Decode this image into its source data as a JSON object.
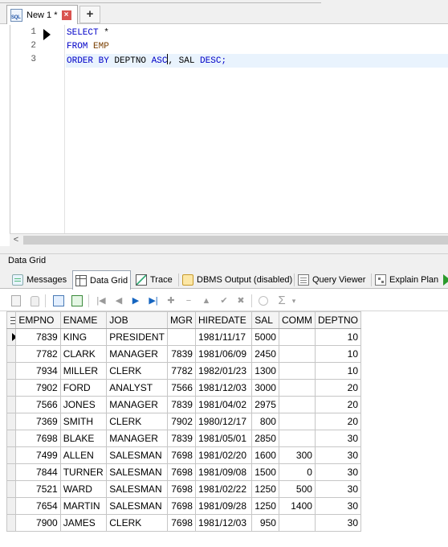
{
  "document_tab": {
    "title": "New 1 *",
    "icon": "sql-file-icon",
    "close_glyph": "×",
    "add_glyph": "+"
  },
  "editor": {
    "line_numbers": [
      "1",
      "2",
      "3"
    ],
    "lines": [
      {
        "t1": "SELECT",
        "t2": " *"
      },
      {
        "t1": "FROM",
        "t2": " ",
        "t3": "EMP"
      },
      {
        "t1": "ORDER BY",
        "t2": " DEPTNO ",
        "t3": "ASC",
        "t4": ", SAL ",
        "t5": "DESC;"
      }
    ],
    "colors": {
      "keyword": "#0000c8",
      "identifier": "#7a3f00",
      "active_line": "#e9f3fd"
    }
  },
  "scrollbar": {
    "left_arrow": "<"
  },
  "results_panel": {
    "title": "Data Grid",
    "tabs": [
      {
        "label": "Messages",
        "icon": "messages-icon"
      },
      {
        "label": "Data Grid",
        "icon": "data-grid-icon",
        "selected": true
      },
      {
        "label": "Trace",
        "icon": "trace-icon"
      },
      {
        "label": "DBMS Output (disabled)",
        "icon": "dbms-output-icon"
      },
      {
        "label": "Query Viewer",
        "icon": "query-viewer-icon"
      },
      {
        "label": "Explain Plan",
        "icon": "explain-plan-icon"
      }
    ]
  },
  "grid_toolbar": {
    "glyphs": {
      "first": "|◀",
      "prev": "◀",
      "next": "▶",
      "last": "▶|",
      "insert": "✚",
      "delete": "−",
      "up": "▲",
      "post": "✔",
      "cancel": "✖",
      "sum": "Σ",
      "dropdown": "▾"
    }
  },
  "grid": {
    "columns": [
      "EMPNO",
      "ENAME",
      "JOB",
      "MGR",
      "HIREDATE",
      "SAL",
      "COMM",
      "DEPTNO"
    ],
    "rows": [
      [
        "7839",
        "KING",
        "PRESIDENT",
        "",
        "1981/11/17",
        "5000",
        "",
        "10"
      ],
      [
        "7782",
        "CLARK",
        "MANAGER",
        "7839",
        "1981/06/09",
        "2450",
        "",
        "10"
      ],
      [
        "7934",
        "MILLER",
        "CLERK",
        "7782",
        "1982/01/23",
        "1300",
        "",
        "10"
      ],
      [
        "7902",
        "FORD",
        "ANALYST",
        "7566",
        "1981/12/03",
        "3000",
        "",
        "20"
      ],
      [
        "7566",
        "JONES",
        "MANAGER",
        "7839",
        "1981/04/02",
        "2975",
        "",
        "20"
      ],
      [
        "7369",
        "SMITH",
        "CLERK",
        "7902",
        "1980/12/17",
        "800",
        "",
        "20"
      ],
      [
        "7698",
        "BLAKE",
        "MANAGER",
        "7839",
        "1981/05/01",
        "2850",
        "",
        "30"
      ],
      [
        "7499",
        "ALLEN",
        "SALESMAN",
        "7698",
        "1981/02/20",
        "1600",
        "300",
        "30"
      ],
      [
        "7844",
        "TURNER",
        "SALESMAN",
        "7698",
        "1981/09/08",
        "1500",
        "0",
        "30"
      ],
      [
        "7521",
        "WARD",
        "SALESMAN",
        "7698",
        "1981/02/22",
        "1250",
        "500",
        "30"
      ],
      [
        "7654",
        "MARTIN",
        "SALESMAN",
        "7698",
        "1981/09/28",
        "1250",
        "1400",
        "30"
      ],
      [
        "7900",
        "JAMES",
        "CLERK",
        "7698",
        "1981/12/03",
        "950",
        "",
        "30"
      ]
    ],
    "current_row": 0
  }
}
